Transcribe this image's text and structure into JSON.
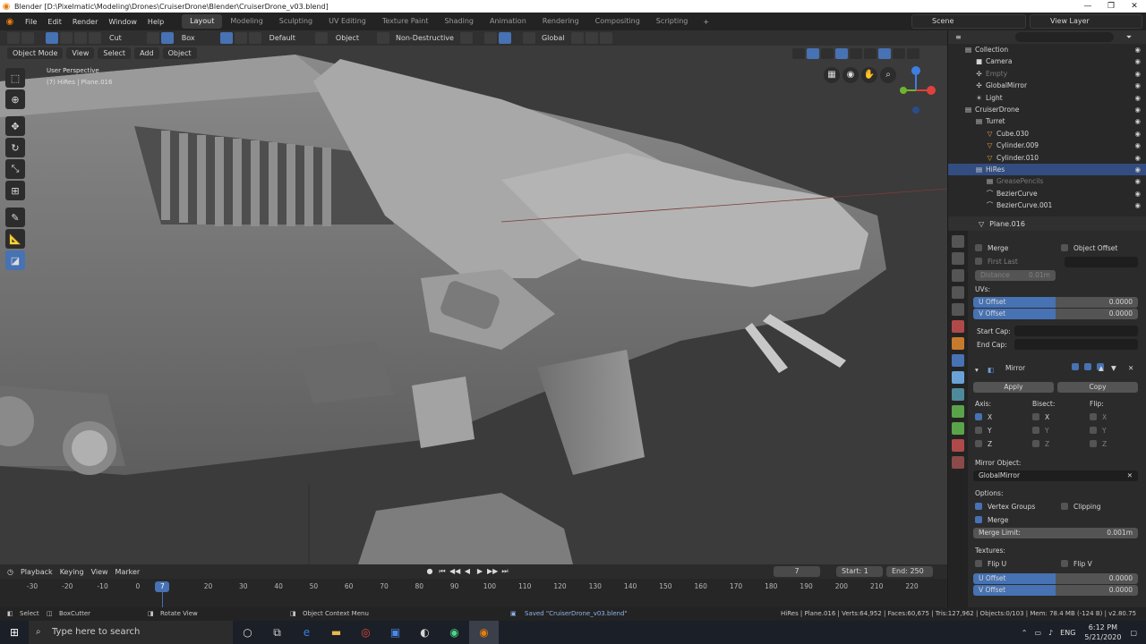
{
  "window": {
    "title": "Blender [D:\\Pixelmatic\\Modeling\\Drones\\CruiserDrone\\Blender\\CruiserDrone_v03.blend]",
    "controls": [
      "—",
      "❐",
      "✕"
    ]
  },
  "menubar": {
    "menus": [
      "File",
      "Edit",
      "Render",
      "Window",
      "Help"
    ],
    "workspaces": [
      "Layout",
      "Modeling",
      "Sculpting",
      "UV Editing",
      "Texture Paint",
      "Shading",
      "Animation",
      "Rendering",
      "Compositing",
      "Scripting"
    ],
    "active_workspace": "Layout",
    "add_tab": "+",
    "scene": "Scene",
    "view_layer": "View Layer"
  },
  "toolheader": {
    "operation": "Cut",
    "select_shape": "Box",
    "orientation": "Default",
    "object_label": "Object",
    "mode": "Non-Destructive",
    "transform_orientation": "Global"
  },
  "viewport": {
    "mode": "Object Mode",
    "menus": [
      "View",
      "Select",
      "Add",
      "Object"
    ],
    "view_name": "User Perspective",
    "object_info": "(7) HiRes | Plane.016",
    "gizmo": {
      "x_color": "#e0413c",
      "y_color": "#6eb52c",
      "z_color": "#3e7ee0"
    }
  },
  "timeline": {
    "menus": [
      "Playback",
      "Keying",
      "View",
      "Marker"
    ],
    "current_frame": "7",
    "start_label": "Start:",
    "start": "1",
    "end_label": "End:",
    "end": "250",
    "ticks": [
      "-30",
      "-20",
      "-10",
      "0",
      "20",
      "30",
      "40",
      "50",
      "60",
      "70",
      "80",
      "90",
      "100",
      "110",
      "120",
      "130",
      "140",
      "150",
      "160",
      "170",
      "180",
      "190",
      "200",
      "210",
      "220"
    ],
    "cursor": "7"
  },
  "statusbar": {
    "select": "Select",
    "tool": "BoxCutter",
    "rotate": "Rotate View",
    "context": "Object Context Menu",
    "saved": "Saved \"CruiserDrone_v03.blend\"",
    "stats": "HiRes | Plane.016 | Verts:64,952 | Faces:60,675 | Tris:127,962 | Objects:0/103 | Mem: 78.4 MB (-124 B) | v2.80.75"
  },
  "outliner": {
    "rows": [
      {
        "label": "Collection",
        "indent": 1,
        "icon": "▤",
        "eye": true,
        "selected": false,
        "dim": false
      },
      {
        "label": "Camera",
        "indent": 2,
        "icon": "■",
        "eye": true,
        "selected": false,
        "dim": false
      },
      {
        "label": "Empty",
        "indent": 2,
        "icon": "✣",
        "eye": true,
        "selected": false,
        "dim": true
      },
      {
        "label": "GlobalMirror",
        "indent": 2,
        "icon": "✣",
        "eye": true,
        "selected": false,
        "dim": false
      },
      {
        "label": "Light",
        "indent": 2,
        "icon": "☀",
        "eye": true,
        "selected": false,
        "dim": false
      },
      {
        "label": "CruiserDrone",
        "indent": 1,
        "icon": "▤",
        "eye": true,
        "selected": false,
        "dim": false
      },
      {
        "label": "Turret",
        "indent": 2,
        "icon": "▤",
        "eye": true,
        "selected": false,
        "dim": false
      },
      {
        "label": "Cube.030",
        "indent": 3,
        "icon": "▽",
        "eye": true,
        "selected": false,
        "dim": false
      },
      {
        "label": "Cylinder.009",
        "indent": 3,
        "icon": "▽",
        "eye": true,
        "selected": false,
        "dim": false
      },
      {
        "label": "Cylinder.010",
        "indent": 3,
        "icon": "▽",
        "eye": true,
        "selected": false,
        "dim": false
      },
      {
        "label": "HiRes",
        "indent": 2,
        "icon": "▤",
        "eye": true,
        "selected": true,
        "dim": false
      },
      {
        "label": "GreasePencils",
        "indent": 3,
        "icon": "▤",
        "eye": true,
        "selected": false,
        "dim": true
      },
      {
        "label": "BezierCurve",
        "indent": 3,
        "icon": "⌒",
        "eye": true,
        "selected": false,
        "dim": false
      },
      {
        "label": "BezierCurve.001",
        "indent": 3,
        "icon": "⌒",
        "eye": true,
        "selected": false,
        "dim": false
      }
    ]
  },
  "properties": {
    "object": "Plane.016",
    "merge": "Merge",
    "object_offset": "Object Offset",
    "first_last": "First Last",
    "distance_label": "Distance",
    "distance": "0.01m",
    "uvs_label": "UVs:",
    "u_offset_label": "U Offset",
    "u_offset": "0.0000",
    "v_offset_label": "V Offset",
    "v_offset": "0.0000",
    "start_cap": "Start Cap:",
    "end_cap": "End Cap:",
    "modifier_name": "Mirror",
    "apply": "Apply",
    "copy": "Copy",
    "axis_label": "Axis:",
    "bisect_label": "Bisect:",
    "flip_label": "Flip:",
    "axes": [
      "X",
      "Y",
      "Z"
    ],
    "mirror_object_label": "Mirror Object:",
    "mirror_object": "GlobalMirror",
    "options_label": "Options:",
    "vertex_groups": "Vertex Groups",
    "clipping": "Clipping",
    "merge2": "Merge",
    "merge_limit_label": "Merge Limit:",
    "merge_limit": "0.001m",
    "textures_label": "Textures:",
    "flip_u": "Flip U",
    "flip_v": "Flip V",
    "u_offset2": "0.0000",
    "v_offset2": "0.0000",
    "accent": "#4772b3"
  },
  "taskbar": {
    "search_placeholder": "Type here to search",
    "lang": "ENG",
    "time": "6:12 PM",
    "date": "5/21/2020"
  }
}
